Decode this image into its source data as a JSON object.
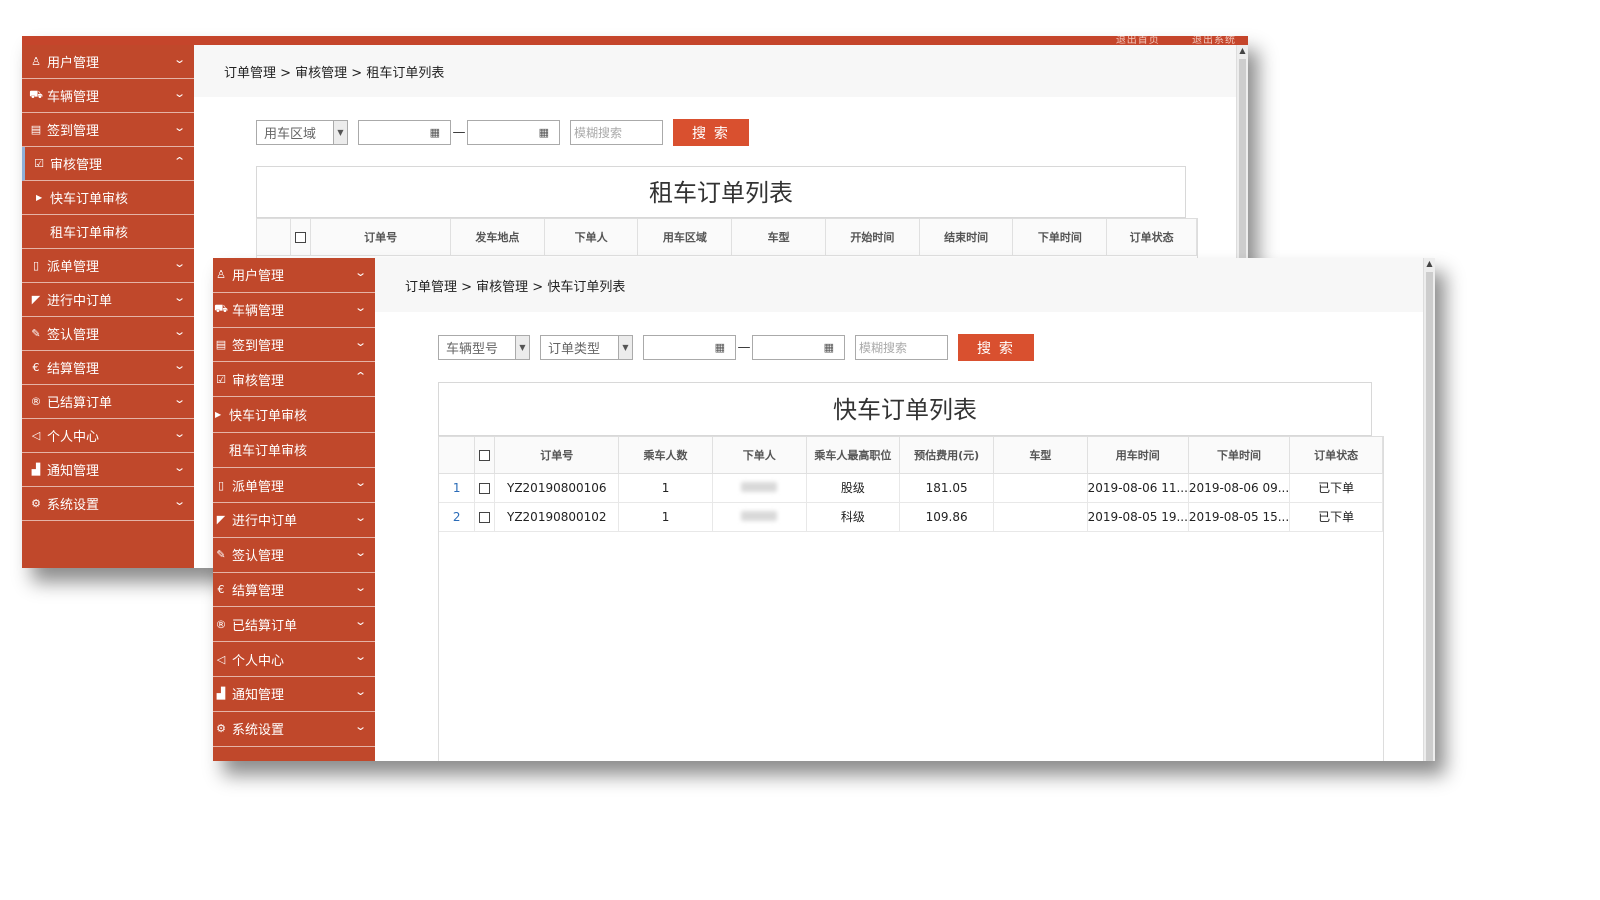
{
  "menu": {
    "items": [
      {
        "label": "用户管理",
        "icon": "user-icon",
        "glyph": "♙"
      },
      {
        "label": "车辆管理",
        "icon": "car-icon",
        "glyph": "⛟"
      },
      {
        "label": "签到管理",
        "icon": "checkin-icon",
        "glyph": "▤"
      },
      {
        "label": "审核管理",
        "icon": "audit-icon",
        "glyph": "☑"
      },
      {
        "label": "派单管理",
        "icon": "dispatch-icon",
        "glyph": "▯"
      },
      {
        "label": "进行中订单",
        "icon": "ongoing-icon",
        "glyph": "◤"
      },
      {
        "label": "签认管理",
        "icon": "sign-icon",
        "glyph": "✎"
      },
      {
        "label": "结算管理",
        "icon": "settle-icon",
        "glyph": "€"
      },
      {
        "label": "已结算订单",
        "icon": "settled-icon",
        "glyph": "®"
      },
      {
        "label": "个人中心",
        "icon": "speaker-icon",
        "glyph": "◁"
      },
      {
        "label": "通知管理",
        "icon": "notice-icon",
        "glyph": "▟"
      },
      {
        "label": "系统设置",
        "icon": "settings-icon",
        "glyph": "⚙"
      }
    ],
    "sub_items": [
      "快车订单审核",
      "租车订单审核"
    ]
  },
  "back_window": {
    "top_links": [
      "退出首页",
      "退出系统"
    ],
    "breadcrumb": "订单管理 > 审核管理 > 租车订单列表",
    "filters": {
      "area_select": "用车区域",
      "keyword_placeholder": "模糊搜索",
      "search_button": "搜 索"
    },
    "title": "租车订单列表",
    "columns": [
      "订单号",
      "发车地点",
      "下单人",
      "用车区域",
      "车型",
      "开始时间",
      "结束时间",
      "下单时间",
      "订单状态"
    ]
  },
  "front_window": {
    "breadcrumb": "订单管理 > 审核管理 > 快车订单列表",
    "filters": {
      "vehicle_model_select": "车辆型号",
      "order_type_select": "订单类型",
      "keyword_placeholder": "模糊搜索",
      "search_button": "搜 索"
    },
    "title": "快车订单列表",
    "columns": [
      "订单号",
      "乘车人数",
      "下单人",
      "乘车人最高职位",
      "预估费用(元)",
      "车型",
      "用车时间",
      "下单时间",
      "订单状态"
    ],
    "rows": [
      {
        "index": "1",
        "order_no": "YZ20190800106",
        "passengers": "1",
        "position": "股级",
        "fee": "181.05",
        "model": "",
        "use_time": "2019-08-06 11...",
        "order_time": "2019-08-06 09...",
        "status": "已下单"
      },
      {
        "index": "2",
        "order_no": "YZ20190800102",
        "passengers": "1",
        "position": "科级",
        "fee": "109.86",
        "model": "",
        "use_time": "2019-08-05 19...",
        "order_time": "2019-08-05 15...",
        "status": "已下单"
      }
    ]
  }
}
